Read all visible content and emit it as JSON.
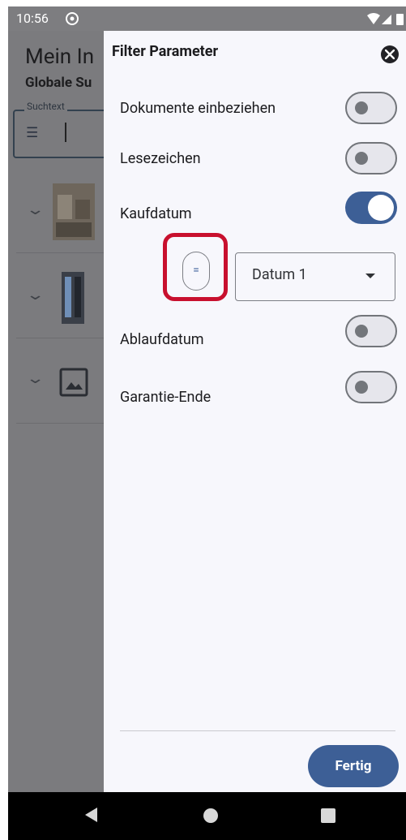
{
  "status_bar": {
    "time": "10:56",
    "icons": [
      "sync-icon",
      "wifi-icon",
      "signal-icon",
      "battery-icon"
    ]
  },
  "background": {
    "title": "Mein In",
    "subtitle": "Globale Su",
    "search_label": "Suchtext",
    "items": [
      "image-thumbnail",
      "pc-case-thumbnail",
      "image-placeholder-icon"
    ]
  },
  "drawer": {
    "title": "Filter Parameter",
    "options": [
      {
        "label": "Dokumente einbeziehen",
        "checked": false
      },
      {
        "label": "Lesezeichen",
        "checked": false
      },
      {
        "label": "Kaufdatum",
        "checked": true
      },
      {
        "label": "Ablaufdatum",
        "checked": false
      },
      {
        "label": "Garantie-Ende",
        "checked": false
      }
    ],
    "date_filter": {
      "operator": "=",
      "selected": "Datum 1"
    },
    "done_label": "Fertig"
  },
  "colors": {
    "primary": "#3d5f96",
    "highlight": "#c8102e",
    "scrim": "#7b7b7e"
  }
}
